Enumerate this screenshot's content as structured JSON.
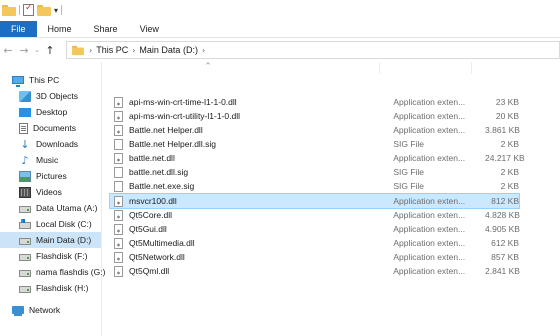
{
  "qat": {
    "dropdown_glyph": "▾"
  },
  "ribbon": {
    "tabs": [
      "File",
      "Home",
      "Share",
      "View"
    ]
  },
  "nav": {
    "back": "←",
    "forward": "→",
    "recent": "⌄",
    "up": "↑"
  },
  "address": {
    "crumbs": [
      "This PC",
      "Main Data (D:)"
    ],
    "separator": "›"
  },
  "sidebar": {
    "items": [
      {
        "label": "This PC",
        "icon": "this-pc-icon"
      },
      {
        "label": "3D Objects",
        "icon": "3d-objects-icon"
      },
      {
        "label": "Desktop",
        "icon": "desktop-icon"
      },
      {
        "label": "Documents",
        "icon": "documents-icon"
      },
      {
        "label": "Downloads",
        "icon": "downloads-icon"
      },
      {
        "label": "Music",
        "icon": "music-icon"
      },
      {
        "label": "Pictures",
        "icon": "pictures-icon"
      },
      {
        "label": "Videos",
        "icon": "videos-icon"
      },
      {
        "label": "Data Utama (A:)",
        "icon": "drive-icon"
      },
      {
        "label": "Local Disk (C:)",
        "icon": "system-drive-icon"
      },
      {
        "label": "Main Data (D:)",
        "icon": "drive-icon",
        "selected": true
      },
      {
        "label": "Flashdisk (F:)",
        "icon": "drive-icon"
      },
      {
        "label": "nama flashdis (G:)",
        "icon": "drive-icon"
      },
      {
        "label": "Flashdisk (H:)",
        "icon": "drive-icon"
      },
      {
        "label": "Network",
        "icon": "network-icon"
      }
    ]
  },
  "list": {
    "sort_indicator": "^",
    "files": [
      {
        "name": "api-ms-win-crt-time-l1-1-0.dll",
        "type": "Application exten...",
        "size": "23 KB",
        "kind": "dll"
      },
      {
        "name": "api-ms-win-crt-utility-l1-1-0.dll",
        "type": "Application exten...",
        "size": "20 KB",
        "kind": "dll"
      },
      {
        "name": "Battle.net Helper.dll",
        "type": "Application exten...",
        "size": "3.861 KB",
        "kind": "dll"
      },
      {
        "name": "Battle.net Helper.dll.sig",
        "type": "SIG File",
        "size": "2 KB",
        "kind": "sig"
      },
      {
        "name": "battle.net.dll",
        "type": "Application exten...",
        "size": "24.217 KB",
        "kind": "dll"
      },
      {
        "name": "battle.net.dll.sig",
        "type": "SIG File",
        "size": "2 KB",
        "kind": "sig"
      },
      {
        "name": "Battle.net.exe.sig",
        "type": "SIG File",
        "size": "2 KB",
        "kind": "sig"
      },
      {
        "name": "msvcr100.dll",
        "type": "Application exten...",
        "size": "812 KB",
        "kind": "dll",
        "selected": true
      },
      {
        "name": "Qt5Core.dll",
        "type": "Application exten...",
        "size": "4.828 KB",
        "kind": "dll"
      },
      {
        "name": "Qt5Gui.dll",
        "type": "Application exten...",
        "size": "4.905 KB",
        "kind": "dll"
      },
      {
        "name": "Qt5Multimedia.dll",
        "type": "Application exten...",
        "size": "612 KB",
        "kind": "dll"
      },
      {
        "name": "Qt5Network.dll",
        "type": "Application exten...",
        "size": "857 KB",
        "kind": "dll"
      },
      {
        "name": "Qt5Qml.dll",
        "type": "Application exten...",
        "size": "2.841 KB",
        "kind": "dll"
      }
    ]
  },
  "colors": {
    "file_tab": "#1a6fc4",
    "selection": "#cce8ff",
    "nav_selection": "#cce4f7"
  }
}
